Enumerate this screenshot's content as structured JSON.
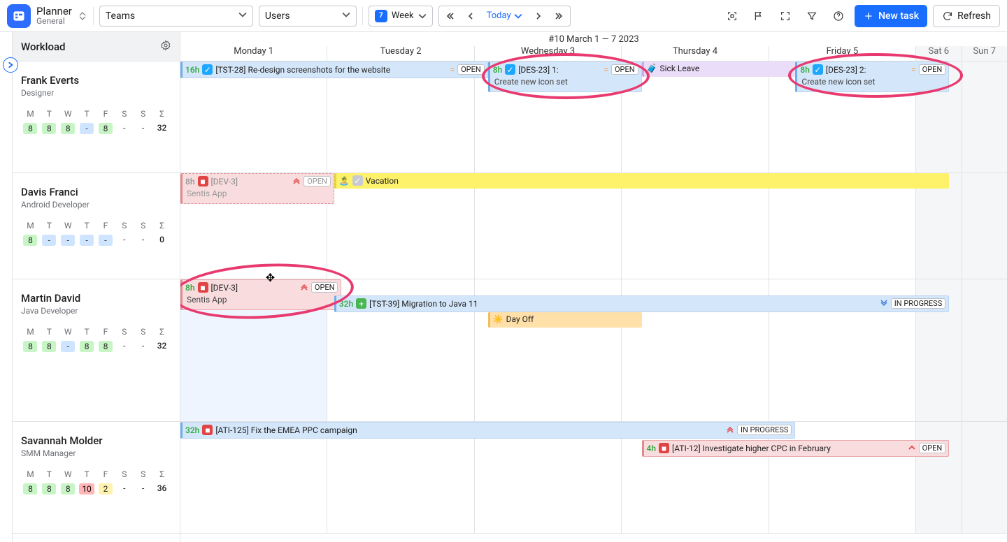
{
  "app": {
    "name": "Planner",
    "sub": "General"
  },
  "toolbar": {
    "teams_label": "Teams",
    "users_label": "Users",
    "view_label": "Week",
    "today_label": "Today",
    "new_task": "New task",
    "refresh": "Refresh"
  },
  "calendar": {
    "range": "#10 March 1 — 7 2023",
    "days": [
      "Monday 1",
      "Tuesday 2",
      "Wednesday 3",
      "Thursday 4",
      "Friday 5",
      "Sat 6",
      "Sun 7"
    ]
  },
  "sidebar": {
    "title": "Workload"
  },
  "dayHeads": [
    "M",
    "T",
    "W",
    "T",
    "F",
    "S",
    "S",
    "Σ"
  ],
  "people": [
    {
      "name": "Frank Everts",
      "role": "Designer",
      "cells": [
        {
          "v": "8",
          "c": "green"
        },
        {
          "v": "8",
          "c": "green"
        },
        {
          "v": "8",
          "c": "green"
        },
        {
          "v": "-",
          "c": "blue"
        },
        {
          "v": "8",
          "c": "green"
        },
        {
          "v": "-",
          "c": "none"
        },
        {
          "v": "-",
          "c": "none"
        },
        {
          "v": "32",
          "c": "sum"
        }
      ]
    },
    {
      "name": "Davis Franci",
      "role": "Android Developer",
      "cells": [
        {
          "v": "8",
          "c": "green"
        },
        {
          "v": "-",
          "c": "blue"
        },
        {
          "v": "-",
          "c": "blue"
        },
        {
          "v": "-",
          "c": "blue"
        },
        {
          "v": "-",
          "c": "blue"
        },
        {
          "v": "-",
          "c": "none"
        },
        {
          "v": "-",
          "c": "none"
        },
        {
          "v": "0",
          "c": "sum"
        }
      ]
    },
    {
      "name": "Martin David",
      "role": "Java Developer",
      "cells": [
        {
          "v": "8",
          "c": "green"
        },
        {
          "v": "8",
          "c": "green"
        },
        {
          "v": "-",
          "c": "blue"
        },
        {
          "v": "8",
          "c": "green"
        },
        {
          "v": "8",
          "c": "green"
        },
        {
          "v": "-",
          "c": "none"
        },
        {
          "v": "-",
          "c": "none"
        },
        {
          "v": "32",
          "c": "sum"
        }
      ]
    },
    {
      "name": "Savannah Molder",
      "role": "SMM Manager",
      "cells": [
        {
          "v": "8",
          "c": "green"
        },
        {
          "v": "8",
          "c": "green"
        },
        {
          "v": "8",
          "c": "green"
        },
        {
          "v": "10",
          "c": "red"
        },
        {
          "v": "2",
          "c": "yellow"
        },
        {
          "v": "-",
          "c": "none"
        },
        {
          "v": "-",
          "c": "none"
        },
        {
          "v": "36",
          "c": "sum"
        }
      ]
    }
  ],
  "tasks": {
    "frank_16h_title": "[TST-28] Re-design screenshots for the website",
    "frank_16h_hours": "16h",
    "frank_16h_status": "OPEN",
    "des23_1_hours": "8h",
    "des23_1_title": "[DES-23] 1:",
    "des23_1_sub": "Create new icon set",
    "des23_1_status": "OPEN",
    "sick": "Sick Leave",
    "des23_2_hours": "8h",
    "des23_2_title": "[DES-23] 2:",
    "des23_2_sub": "Create new icon set",
    "des23_2_status": "OPEN",
    "davis_8h": "8h",
    "davis_title": "[DEV-3]",
    "davis_sub": "Sentis App",
    "davis_status": "OPEN",
    "vacation": "Vacation",
    "martin_8h": "8h",
    "martin_title": "[DEV-3]",
    "martin_sub": "Sentis App",
    "martin_status": "OPEN",
    "martin_big_h": "32h",
    "martin_big_title": "[TST-39] Migration to Java 11",
    "martin_big_status": "IN PROGRESS",
    "dayoff": "Day Off",
    "sav_big_h": "32h",
    "sav_big_title": "[ATI-125] Fix the EMEA PPC campaign",
    "sav_big_status": "IN PROGRESS",
    "sav_4h": "4h",
    "sav_4h_title": "[ATI-12] Investigate higher CPC in February",
    "sav_4h_status": "OPEN"
  }
}
